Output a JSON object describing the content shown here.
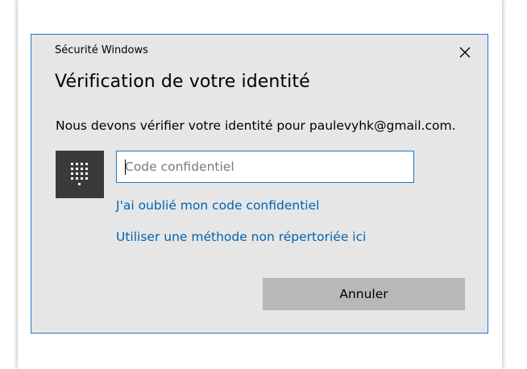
{
  "dialog": {
    "app_title": "Sécurité Windows",
    "heading": "Vérification de votre identité",
    "message": "Nous devons vérifier votre identité pour paulevyhk@gmail.com.",
    "pin_field": {
      "placeholder": "Code confidentiel",
      "value": ""
    },
    "links": {
      "forgot_pin": "J'ai oublié mon code confidentiel",
      "other_method": "Utiliser une méthode non répertoriée ici"
    },
    "buttons": {
      "cancel": "Annuler"
    },
    "icons": {
      "close": "close-icon",
      "pin": "keypad-icon"
    }
  },
  "colors": {
    "dialog_background": "#e6e6e6",
    "accent_border": "#1979ca",
    "link": "#0063b1",
    "pin_tile": "#3a3a3a",
    "cancel_button": "#b8b8b8"
  }
}
